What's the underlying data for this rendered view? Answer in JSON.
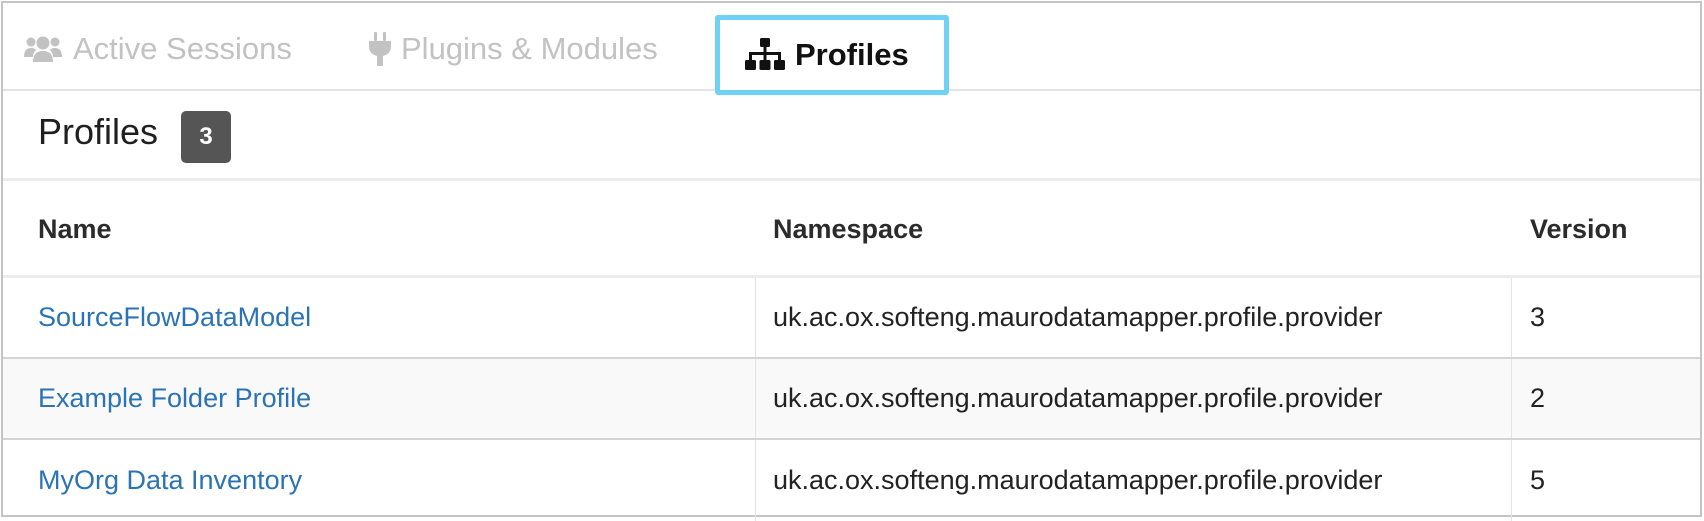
{
  "tabs": [
    {
      "label": "Active Sessions",
      "icon": "users-icon",
      "active": false
    },
    {
      "label": "Plugins & Modules",
      "icon": "plug-icon",
      "active": false
    },
    {
      "label": "Profiles",
      "icon": "sitemap-icon",
      "active": true
    }
  ],
  "panel": {
    "title": "Profiles",
    "count": "3"
  },
  "table": {
    "columns": [
      "Name",
      "Namespace",
      "Version"
    ],
    "rows": [
      {
        "name": "SourceFlowDataModel",
        "namespace": "uk.ac.ox.softeng.maurodatamapper.profile.provider",
        "version": "3"
      },
      {
        "name": "Example Folder Profile",
        "namespace": "uk.ac.ox.softeng.maurodatamapper.profile.provider",
        "version": "2"
      },
      {
        "name": "MyOrg Data Inventory",
        "namespace": "uk.ac.ox.softeng.maurodatamapper.profile.provider",
        "version": "5"
      }
    ]
  },
  "colors": {
    "active_tab_outline": "#6fd2f5",
    "link": "#2a73b5",
    "badge": "#555555",
    "inactive_tab": "#c2c2c2"
  }
}
